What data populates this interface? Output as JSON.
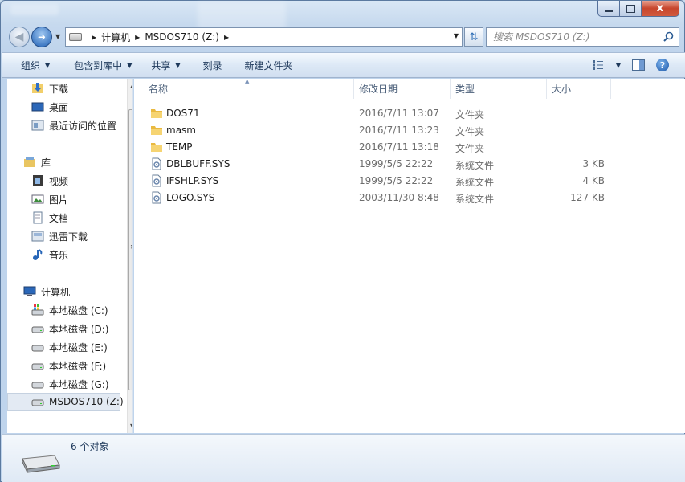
{
  "window": {
    "caption": {
      "minimize": "",
      "maximize": "",
      "close": "x"
    }
  },
  "address_bar": {
    "breadcrumbs": [
      "计算机",
      "MSDOS710 (Z:)"
    ]
  },
  "search": {
    "placeholder": "搜索 MSDOS710 (Z:)"
  },
  "toolbar": {
    "organize": "组织",
    "include_in_library": "包含到库中",
    "share": "共享",
    "burn": "刻录",
    "new_folder": "新建文件夹"
  },
  "nav": {
    "favorites": [
      {
        "label": "下载",
        "icon": "download-folder-icon"
      },
      {
        "label": "桌面",
        "icon": "desktop-icon"
      },
      {
        "label": "最近访问的位置",
        "icon": "recent-places-icon"
      }
    ],
    "libraries_label": "库",
    "libraries": [
      {
        "label": "视频",
        "icon": "video-library-icon"
      },
      {
        "label": "图片",
        "icon": "picture-library-icon"
      },
      {
        "label": "文档",
        "icon": "document-library-icon"
      },
      {
        "label": "迅雷下载",
        "icon": "xunlei-download-icon"
      },
      {
        "label": "音乐",
        "icon": "music-library-icon"
      }
    ],
    "computer_label": "计算机",
    "drives": [
      {
        "label": "本地磁盘 (C:)",
        "icon": "system-drive-icon"
      },
      {
        "label": "本地磁盘 (D:)",
        "icon": "drive-icon"
      },
      {
        "label": "本地磁盘 (E:)",
        "icon": "drive-icon"
      },
      {
        "label": "本地磁盘 (F:)",
        "icon": "drive-icon"
      },
      {
        "label": "本地磁盘 (G:)",
        "icon": "drive-icon"
      },
      {
        "label": "MSDOS710 (Z:)",
        "icon": "drive-icon",
        "selected": true
      }
    ]
  },
  "columns": {
    "name": "名称",
    "date": "修改日期",
    "type": "类型",
    "size": "大小"
  },
  "files": [
    {
      "name": "DOS71",
      "date": "2016/7/11 13:07",
      "type": "文件夹",
      "size": "",
      "icon": "folder-icon"
    },
    {
      "name": "masm",
      "date": "2016/7/11 13:23",
      "type": "文件夹",
      "size": "",
      "icon": "folder-icon"
    },
    {
      "name": "TEMP",
      "date": "2016/7/11 13:18",
      "type": "文件夹",
      "size": "",
      "icon": "folder-icon"
    },
    {
      "name": "DBLBUFF.SYS",
      "date": "1999/5/5 22:22",
      "type": "系统文件",
      "size": "3 KB",
      "icon": "system-file-icon"
    },
    {
      "name": "IFSHLP.SYS",
      "date": "1999/5/5 22:22",
      "type": "系统文件",
      "size": "4 KB",
      "icon": "system-file-icon"
    },
    {
      "name": "LOGO.SYS",
      "date": "2003/11/30 8:48",
      "type": "系统文件",
      "size": "127 KB",
      "icon": "system-file-icon"
    }
  ],
  "details": {
    "item_count": "6 个对象"
  }
}
